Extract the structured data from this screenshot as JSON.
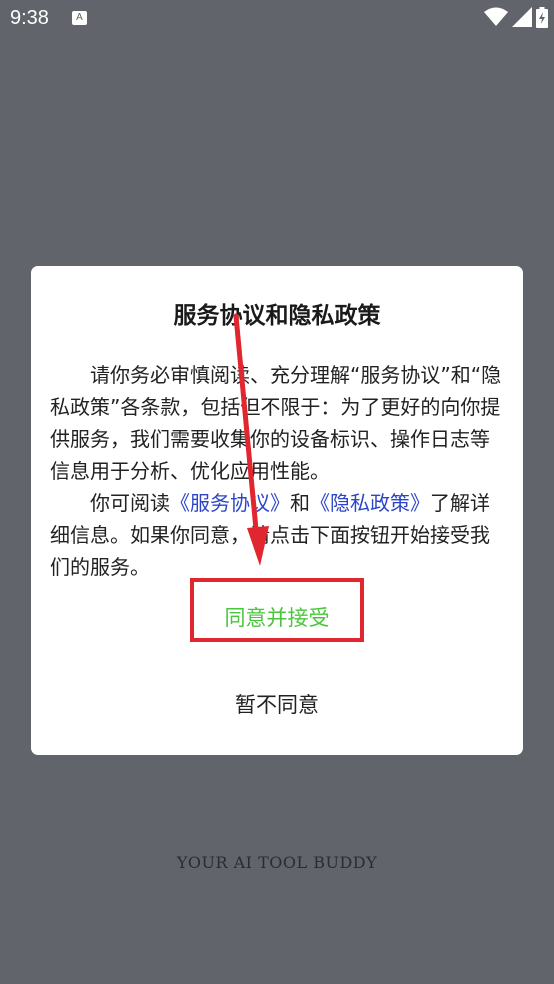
{
  "status_bar": {
    "time": "9:38",
    "app_icon_letter": "A",
    "icons": [
      "wifi-icon",
      "signal-icon",
      "battery-icon"
    ]
  },
  "dialog": {
    "title": "服务协议和隐私政策",
    "paragraph1": "请你务必审慎阅读、充分理解“服务协议”和“隐私政策”各条款，包括但不限于：为了更好的向你提供服务，我们需要收集你的设备标识、操作日志等信息用于分析、优化应用性能。",
    "paragraph2_prefix": "你可阅读",
    "link_service": "《服务协议》",
    "paragraph2_and": "和",
    "link_privacy": "《隐私政策》",
    "paragraph2_suffix": "了解详细信息。如果你同意，请点击下面按钮开始接受我们的服务。",
    "agree_label": "同意并接受",
    "decline_label": "暂不同意"
  },
  "background": {
    "tagline": "YOUR AI TOOL BUDDY"
  },
  "colors": {
    "overlay": "#62646c",
    "agree_text": "#49c63b",
    "link": "#2c45c8",
    "annotation_red": "#e0262f"
  }
}
